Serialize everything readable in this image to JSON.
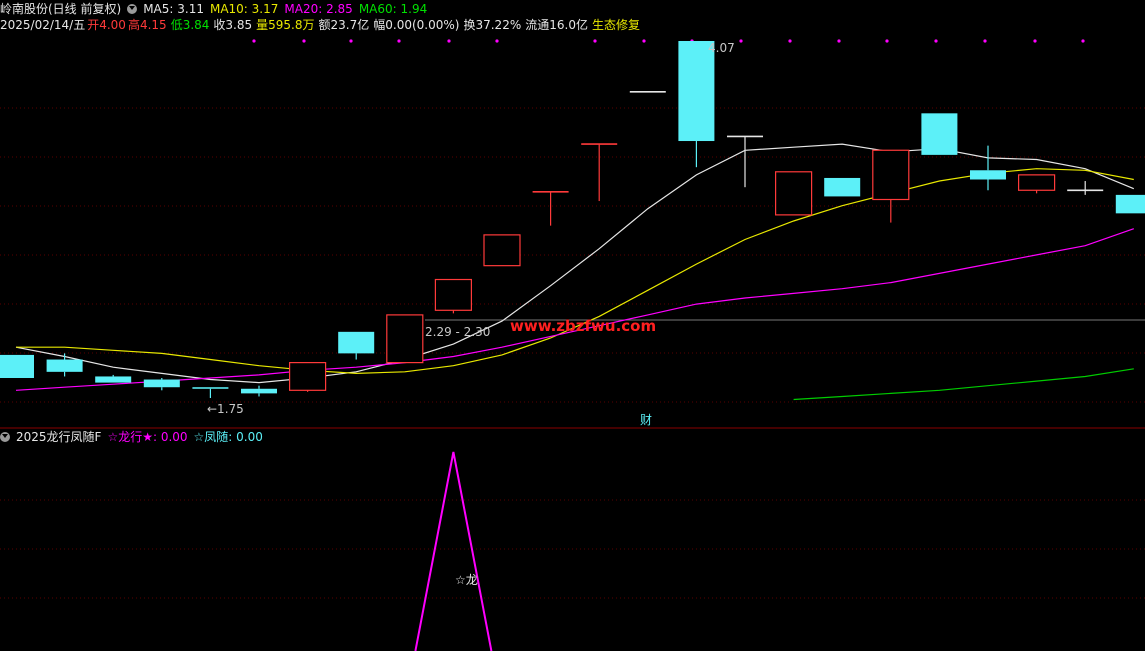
{
  "header": {
    "stock_name": "岭南股份(日线 前复权)",
    "ma5": "MA5: 3.11",
    "ma10": "MA10: 3.17",
    "ma20": "MA20: 2.85",
    "ma60": "MA60: 1.94",
    "date": "2025/02/14/五",
    "open": "开4.00",
    "high": "高4.15",
    "low": "低3.84",
    "close": "收3.85",
    "volume": "量595.8万",
    "amount": "额23.7亿",
    "change": "幅0.00(0.00%)",
    "turnover": "换37.22%",
    "float": "流通16.0亿",
    "concept": "生态修复"
  },
  "annotations": {
    "high_label": "4.07",
    "low_label": "←1.75",
    "range_label": "2.29 - 2.30",
    "watermark": "www.zbzfwu.com",
    "finance_marker": "财",
    "dragon_marker": "☆龙"
  },
  "indicator": {
    "name": "2025龙行凤随F",
    "dragon": "☆龙行★: 0.00",
    "phoenix": "☆凤随: 0.00"
  },
  "colors": {
    "up": "#ff3a3a",
    "down": "#5cf0f8",
    "doji": "#e6e6e6",
    "ma5": "#e6e6e6",
    "ma10": "#e8e800",
    "ma20": "#ff00ff",
    "ma60": "#00cc00",
    "white_text": "#e6e6e6",
    "red_text": "#ff3a3a",
    "green_text": "#00e000",
    "yellow_text": "#e8e800",
    "magenta_text": "#ff00ff",
    "cyan_text": "#5cf0f8"
  },
  "chart_data": [
    {
      "type": "candlestick",
      "title": "",
      "ylim": [
        1.5,
        4.3
      ],
      "candles": [
        {
          "o": 2.03,
          "c": 1.88,
          "h": 2.03,
          "l": 1.88
        },
        {
          "o": 2.0,
          "c": 1.92,
          "h": 2.04,
          "l": 1.89
        },
        {
          "o": 1.89,
          "c": 1.85,
          "h": 1.9,
          "l": 1.85
        },
        {
          "o": 1.87,
          "c": 1.82,
          "h": 1.88,
          "l": 1.8
        },
        {
          "o": 1.82,
          "c": 1.81,
          "h": 1.82,
          "l": 1.75
        },
        {
          "o": 1.81,
          "c": 1.78,
          "h": 1.83,
          "l": 1.76
        },
        {
          "o": 1.8,
          "c": 1.98,
          "h": 1.98,
          "l": 1.79
        },
        {
          "o": 2.18,
          "c": 2.04,
          "h": 2.18,
          "l": 2.0
        },
        {
          "o": 1.98,
          "c": 2.29,
          "h": 2.29,
          "l": 1.98
        },
        {
          "o": 2.32,
          "c": 2.52,
          "h": 2.52,
          "l": 2.3
        },
        {
          "o": 2.61,
          "c": 2.81,
          "h": 2.81,
          "l": 2.61
        },
        {
          "o": 3.09,
          "c": 3.09,
          "h": 3.09,
          "l": 2.87
        },
        {
          "o": 3.4,
          "c": 3.4,
          "h": 3.4,
          "l": 3.03
        },
        {
          "o": 3.74,
          "c": 3.74,
          "h": 3.74,
          "l": 3.74
        },
        {
          "o": 4.07,
          "c": 3.42,
          "h": 4.07,
          "l": 3.25
        },
        {
          "o": 3.45,
          "c": 3.45,
          "h": 3.45,
          "l": 3.12
        },
        {
          "o": 2.94,
          "c": 3.22,
          "h": 3.22,
          "l": 2.94
        },
        {
          "o": 3.18,
          "c": 3.06,
          "h": 3.18,
          "l": 3.06
        },
        {
          "o": 3.04,
          "c": 3.36,
          "h": 3.36,
          "l": 2.89
        },
        {
          "o": 3.6,
          "c": 3.33,
          "h": 3.6,
          "l": 3.33
        },
        {
          "o": 3.23,
          "c": 3.17,
          "h": 3.39,
          "l": 3.1
        },
        {
          "o": 3.1,
          "c": 3.2,
          "h": 3.2,
          "l": 3.08
        },
        {
          "o": 3.1,
          "c": 3.1,
          "h": 3.16,
          "l": 3.07
        },
        {
          "o": 3.07,
          "c": 2.95,
          "h": 3.07,
          "l": 2.95
        }
      ],
      "series": [
        {
          "name": "MA5",
          "values": [
            2.08,
            2.02,
            1.95,
            1.91,
            1.87,
            1.85,
            1.88,
            1.92,
            2.0,
            2.1,
            2.25,
            2.48,
            2.72,
            2.98,
            3.2,
            3.36,
            3.38,
            3.4,
            3.35,
            3.37,
            3.31,
            3.3,
            3.24,
            3.11
          ]
        },
        {
          "name": "MA10",
          "values": [
            2.08,
            2.08,
            2.06,
            2.04,
            2.0,
            1.96,
            1.93,
            1.91,
            1.92,
            1.96,
            2.03,
            2.14,
            2.28,
            2.45,
            2.62,
            2.78,
            2.9,
            3.0,
            3.08,
            3.16,
            3.21,
            3.24,
            3.23,
            3.17
          ]
        },
        {
          "name": "MA20",
          "values": [
            1.8,
            1.82,
            1.84,
            1.86,
            1.88,
            1.9,
            1.93,
            1.95,
            1.98,
            2.02,
            2.08,
            2.15,
            2.22,
            2.29,
            2.36,
            2.4,
            2.43,
            2.46,
            2.5,
            2.56,
            2.62,
            2.68,
            2.74,
            2.85
          ]
        },
        {
          "name": "MA60",
          "start_index": 16,
          "values": [
            1.74,
            1.76,
            1.78,
            1.8,
            1.83,
            1.86,
            1.89,
            1.94
          ]
        }
      ]
    },
    {
      "type": "line",
      "title": "",
      "x_range": [
        0,
        23
      ],
      "series": [
        {
          "name": "☆龙行★",
          "values": [
            0,
            0,
            0,
            0,
            0,
            0,
            0,
            0,
            0,
            0,
            0,
            0,
            0,
            0,
            0,
            0,
            0,
            0,
            0,
            0,
            0,
            0,
            0,
            0
          ],
          "spike_index": 9,
          "spike_value": 1
        }
      ]
    }
  ]
}
